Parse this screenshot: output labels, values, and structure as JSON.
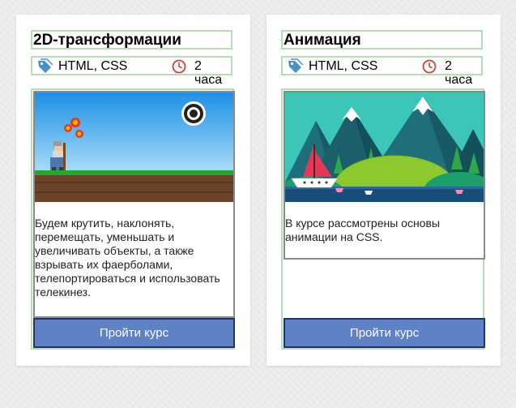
{
  "courses": [
    {
      "title": "2D-трансформации",
      "technologies": "HTML, CSS",
      "duration": "2 часа",
      "description": "Будем крутить, наклонять, перемещать, уменьшать и увеличивать объекты, а также взрывать их фаерболами, телепортироваться и использовать телекинез.",
      "button_label": "Пройти курс"
    },
    {
      "title": "Анимация",
      "technologies": "HTML, CSS",
      "duration": "2 часа",
      "description": "В курсе рассмотрены основы анимации на CSS.",
      "button_label": "Пройти курс"
    }
  ],
  "icons": {
    "tag": "tag-icon",
    "clock": "clock-icon"
  },
  "colors": {
    "button_bg": "#5f82c6",
    "button_border": "#26355a",
    "frame_border": "#b8dcb8",
    "tag_icon": "#4a90c8",
    "clock_icon": "#d04040"
  }
}
